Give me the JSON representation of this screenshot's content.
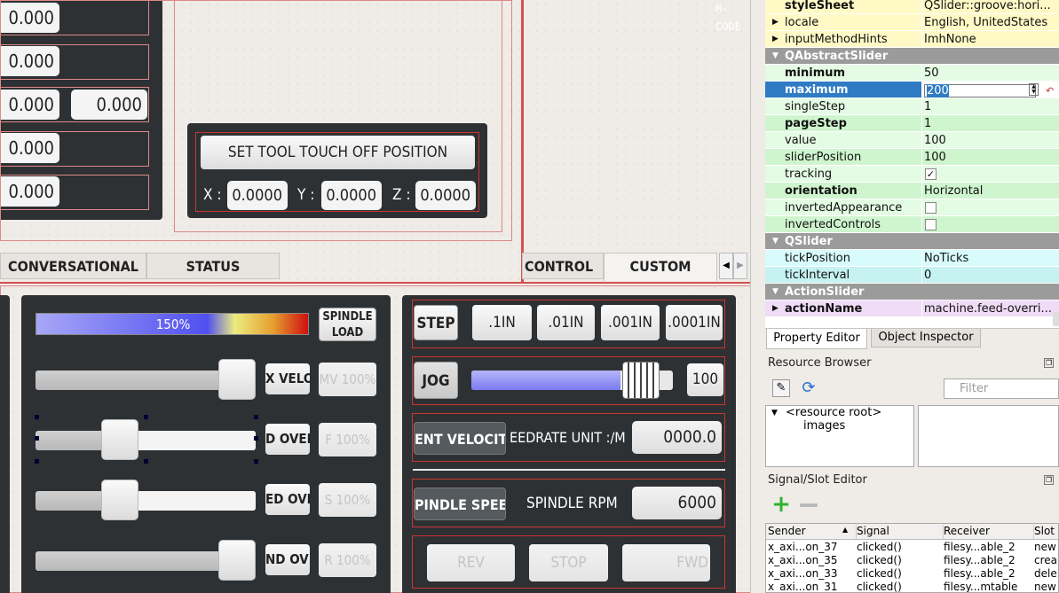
{
  "dro": {
    "values": [
      "0.000",
      "0.000",
      "0.000",
      "0.000",
      "0.000"
    ],
    "extra": "0.000"
  },
  "touchoff": {
    "button": "SET TOOL TOUCH OFF POSITION",
    "x_label": "X :",
    "y_label": "Y :",
    "z_label": "Z :",
    "x": "0.0000",
    "y": "0.0000",
    "z": "0.0000"
  },
  "mcode": "M-\nCODE",
  "tabs": [
    {
      "label": "CONVERSATIONAL"
    },
    {
      "label": "STATUS"
    },
    {
      "label": "CONTROL"
    },
    {
      "label": "CUSTOM"
    }
  ],
  "load_bar": {
    "text": "150%",
    "button": "SPINDLE\nLOAD"
  },
  "sliders": [
    {
      "label": "X VELOC",
      "readout": "MV 100%",
      "value": 1.0
    },
    {
      "label": "D OVERR",
      "readout": "F 100%",
      "value": 0.36
    },
    {
      "label": "ED OVER",
      "readout": "S 100%",
      "value": 0.36
    },
    {
      "label": "ND OVER",
      "readout": "R 100%",
      "value": 1.0
    }
  ],
  "step": {
    "label": "STEP",
    "options": [
      ".1IN",
      ".01IN",
      ".001IN",
      ".0001IN"
    ]
  },
  "jog": {
    "label": "JOG",
    "value": "100",
    "fill": 0.74
  },
  "velocity": {
    "button": "ENT VELOCITY",
    "label": "EEDRATE UNIT :/M",
    "value": "0000.0"
  },
  "spindle": {
    "button": "PINDLE SPEED",
    "label": "SPINDLE RPM",
    "value": "6000"
  },
  "dir": {
    "rev": "REV",
    "stop": "STOP",
    "fwd": "FWD"
  },
  "properties": {
    "rows": [
      {
        "name": "styleSheet",
        "value": "QSlider::groove:hori...",
        "bold": true,
        "bg": "#fff9c6"
      },
      {
        "name": "locale",
        "value": "English, UnitedStates",
        "arrow": true,
        "bg": "#fff9c6"
      },
      {
        "name": "inputMethodHints",
        "value": "ImhNone",
        "arrow": true,
        "bg": "#fff9c6"
      },
      {
        "section": "QAbstractSlider"
      },
      {
        "name": "minimum",
        "value": "50",
        "bold": true,
        "bg": "#e4fbe4"
      },
      {
        "name": "maximum",
        "value": "200",
        "bold": true,
        "selected": true
      },
      {
        "name": "singleStep",
        "value": "1",
        "bg": "#e4fbe4"
      },
      {
        "name": "pageStep",
        "value": "1",
        "bold": true,
        "bg": "#cff5cf"
      },
      {
        "name": "value",
        "value": "100",
        "bg": "#e4fbe4"
      },
      {
        "name": "sliderPosition",
        "value": "100",
        "bg": "#cff5cf"
      },
      {
        "name": "tracking",
        "value": "",
        "check": true,
        "checked": true,
        "bg": "#e4fbe4"
      },
      {
        "name": "orientation",
        "value": "Horizontal",
        "bold": true,
        "bg": "#cff5cf"
      },
      {
        "name": "invertedAppearance",
        "value": "",
        "check": true,
        "checked": false,
        "bg": "#e4fbe4"
      },
      {
        "name": "invertedControls",
        "value": "",
        "check": true,
        "checked": false,
        "bg": "#cff5cf"
      },
      {
        "section": "QSlider"
      },
      {
        "name": "tickPosition",
        "value": "NoTicks",
        "bg": "#d8fbfb"
      },
      {
        "name": "tickInterval",
        "value": "0",
        "bg": "#c6f2f2"
      },
      {
        "section": "ActionSlider"
      },
      {
        "name": "actionName",
        "value": "machine.feed-overri...",
        "bold": true,
        "arrow": true,
        "bg": "#f0dcf6"
      }
    ]
  },
  "tabs_right": {
    "property_editor": "Property Editor",
    "object_inspector": "Object Inspector"
  },
  "resource": {
    "title": "Resource Browser",
    "filter_placeholder": "Filter",
    "root": "<resource root>",
    "child": "images"
  },
  "signals": {
    "title": "Signal/Slot Editor",
    "headers": [
      "Sender",
      "Signal",
      "Receiver",
      "Slot"
    ],
    "rows": [
      [
        "x_axi...on_37",
        "clicked()",
        "filesy...able_2",
        "new"
      ],
      [
        "x_axi...on_35",
        "clicked()",
        "filesy...able_2",
        "crea"
      ],
      [
        "x_axi...on_33",
        "clicked()",
        "filesy...able_2",
        "dele"
      ],
      [
        "x_axi...on_31",
        "clicked()",
        "filesy...mtable",
        "new"
      ]
    ]
  },
  "colors": {
    "panel": "#2e3133",
    "selection": "#2f7bc4",
    "load_start": "#8f8ff0",
    "load_end": "#d71f0f"
  }
}
